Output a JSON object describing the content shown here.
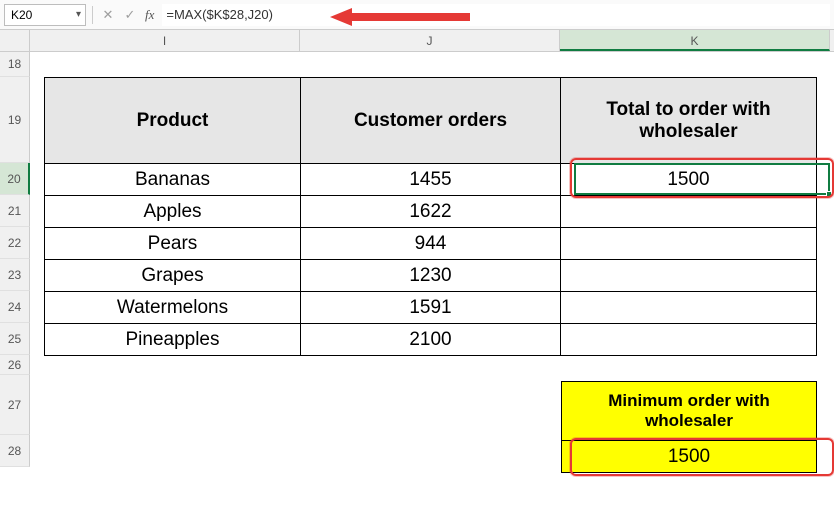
{
  "name_box": "K20",
  "formula": "=MAX($K$28,J20)",
  "columns": [
    "I",
    "J",
    "K"
  ],
  "active_column": "K",
  "rows": [
    "18",
    "19",
    "20",
    "21",
    "22",
    "23",
    "24",
    "25",
    "26",
    "27",
    "28"
  ],
  "active_row": "20",
  "headers": {
    "product": "Product",
    "orders": "Customer orders",
    "total": "Total to order with wholesaler"
  },
  "products": [
    {
      "name": "Bananas",
      "orders": "1455",
      "total": "1500"
    },
    {
      "name": "Apples",
      "orders": "1622",
      "total": ""
    },
    {
      "name": "Pears",
      "orders": "944",
      "total": ""
    },
    {
      "name": "Grapes",
      "orders": "1230",
      "total": ""
    },
    {
      "name": "Watermelons",
      "orders": "1591",
      "total": ""
    },
    {
      "name": "Pineapples",
      "orders": "2100",
      "total": ""
    }
  ],
  "wholesaler": {
    "label": "Minimum order with wholesaler",
    "value": "1500"
  },
  "chart_data": {
    "type": "table",
    "columns": [
      "Product",
      "Customer orders",
      "Total to order with wholesaler"
    ],
    "rows": [
      [
        "Bananas",
        1455,
        1500
      ],
      [
        "Apples",
        1622,
        null
      ],
      [
        "Pears",
        944,
        null
      ],
      [
        "Grapes",
        1230,
        null
      ],
      [
        "Watermelons",
        1591,
        null
      ],
      [
        "Pineapples",
        2100,
        null
      ]
    ],
    "minimum_order_with_wholesaler": 1500,
    "active_cell": "K20",
    "formula_in_active_cell": "=MAX($K$28,J20)"
  }
}
